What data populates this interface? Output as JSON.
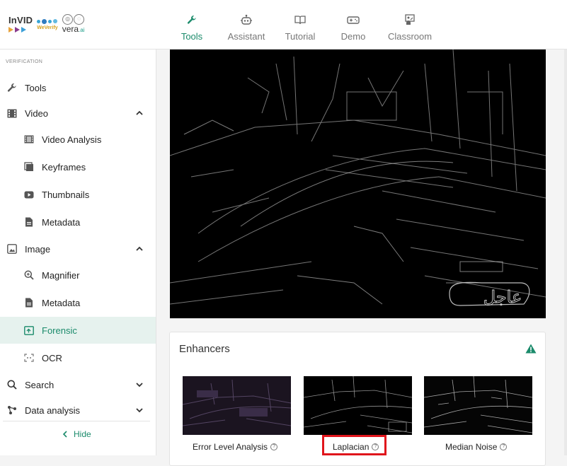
{
  "brand": {
    "invid": "InVID",
    "weverify": "WeVerify",
    "vera": "vera",
    "vera_suffix": ".ai"
  },
  "nav": [
    {
      "label": "Tools",
      "icon": "wrench-icon",
      "active": true
    },
    {
      "label": "Assistant",
      "icon": "robot-icon",
      "active": false
    },
    {
      "label": "Tutorial",
      "icon": "book-icon",
      "active": false
    },
    {
      "label": "Demo",
      "icon": "gamepad-icon",
      "active": false
    },
    {
      "label": "Classroom",
      "icon": "classroom-icon",
      "active": false
    }
  ],
  "sidebar": {
    "section": "VERIFICATION",
    "items": [
      {
        "label": "Tools",
        "icon": "wrench-icon"
      },
      {
        "label": "Video",
        "icon": "film-icon",
        "expanded": true
      },
      {
        "label": "Video Analysis",
        "icon": "film-strip-icon"
      },
      {
        "label": "Keyframes",
        "icon": "frames-icon"
      },
      {
        "label": "Thumbnails",
        "icon": "youtube-icon"
      },
      {
        "label": "Metadata",
        "icon": "document-icon"
      },
      {
        "label": "Image",
        "icon": "image-icon",
        "expanded": true
      },
      {
        "label": "Magnifier",
        "icon": "magnifier-icon"
      },
      {
        "label": "Metadata",
        "icon": "document-icon"
      },
      {
        "label": "Forensic",
        "icon": "forensic-icon",
        "active": true
      },
      {
        "label": "OCR",
        "icon": "ocr-icon"
      },
      {
        "label": "Search",
        "icon": "search-icon",
        "expanded": false
      },
      {
        "label": "Data analysis",
        "icon": "data-analysis-icon",
        "expanded": false
      }
    ],
    "hide_label": "Hide"
  },
  "main": {
    "image_overlay_text": "عاجل",
    "enhancers": {
      "title": "Enhancers",
      "warning_icon": "warning-icon",
      "filters": [
        {
          "label": "Error Level Analysis"
        },
        {
          "label": "Laplacian",
          "highlighted": true
        },
        {
          "label": "Median Noise"
        }
      ]
    }
  },
  "colors": {
    "accent": "#1b8b6b",
    "active_bg": "#e6f2ee",
    "highlight": "#e0151c"
  }
}
